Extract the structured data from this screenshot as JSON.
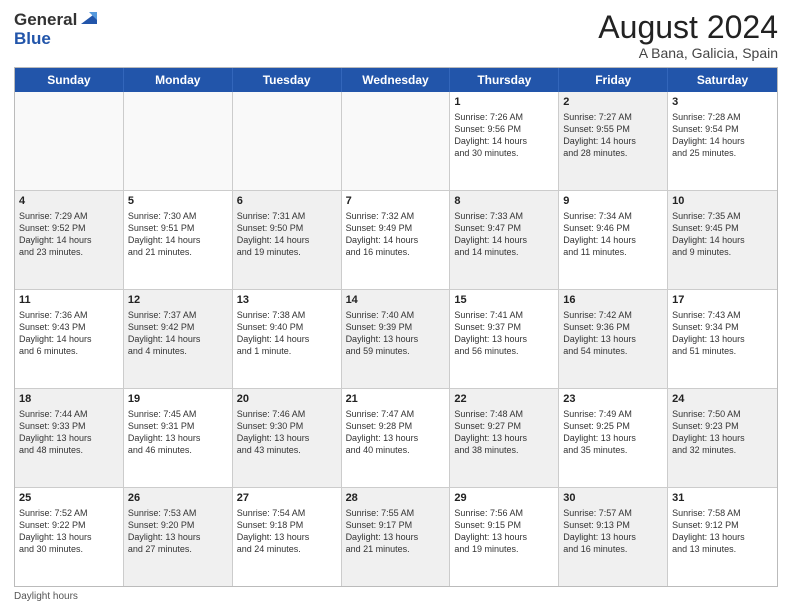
{
  "header": {
    "logo_general": "General",
    "logo_blue": "Blue",
    "month_title": "August 2024",
    "location": "A Bana, Galicia, Spain"
  },
  "weekdays": [
    "Sunday",
    "Monday",
    "Tuesday",
    "Wednesday",
    "Thursday",
    "Friday",
    "Saturday"
  ],
  "footer": "Daylight hours",
  "rows": [
    [
      {
        "day": "",
        "detail": "",
        "shaded": false,
        "empty": true
      },
      {
        "day": "",
        "detail": "",
        "shaded": false,
        "empty": true
      },
      {
        "day": "",
        "detail": "",
        "shaded": false,
        "empty": true
      },
      {
        "day": "",
        "detail": "",
        "shaded": false,
        "empty": true
      },
      {
        "day": "1",
        "detail": "Sunrise: 7:26 AM\nSunset: 9:56 PM\nDaylight: 14 hours\nand 30 minutes.",
        "shaded": false,
        "empty": false
      },
      {
        "day": "2",
        "detail": "Sunrise: 7:27 AM\nSunset: 9:55 PM\nDaylight: 14 hours\nand 28 minutes.",
        "shaded": true,
        "empty": false
      },
      {
        "day": "3",
        "detail": "Sunrise: 7:28 AM\nSunset: 9:54 PM\nDaylight: 14 hours\nand 25 minutes.",
        "shaded": false,
        "empty": false
      }
    ],
    [
      {
        "day": "4",
        "detail": "Sunrise: 7:29 AM\nSunset: 9:52 PM\nDaylight: 14 hours\nand 23 minutes.",
        "shaded": true,
        "empty": false
      },
      {
        "day": "5",
        "detail": "Sunrise: 7:30 AM\nSunset: 9:51 PM\nDaylight: 14 hours\nand 21 minutes.",
        "shaded": false,
        "empty": false
      },
      {
        "day": "6",
        "detail": "Sunrise: 7:31 AM\nSunset: 9:50 PM\nDaylight: 14 hours\nand 19 minutes.",
        "shaded": true,
        "empty": false
      },
      {
        "day": "7",
        "detail": "Sunrise: 7:32 AM\nSunset: 9:49 PM\nDaylight: 14 hours\nand 16 minutes.",
        "shaded": false,
        "empty": false
      },
      {
        "day": "8",
        "detail": "Sunrise: 7:33 AM\nSunset: 9:47 PM\nDaylight: 14 hours\nand 14 minutes.",
        "shaded": true,
        "empty": false
      },
      {
        "day": "9",
        "detail": "Sunrise: 7:34 AM\nSunset: 9:46 PM\nDaylight: 14 hours\nand 11 minutes.",
        "shaded": false,
        "empty": false
      },
      {
        "day": "10",
        "detail": "Sunrise: 7:35 AM\nSunset: 9:45 PM\nDaylight: 14 hours\nand 9 minutes.",
        "shaded": true,
        "empty": false
      }
    ],
    [
      {
        "day": "11",
        "detail": "Sunrise: 7:36 AM\nSunset: 9:43 PM\nDaylight: 14 hours\nand 6 minutes.",
        "shaded": false,
        "empty": false
      },
      {
        "day": "12",
        "detail": "Sunrise: 7:37 AM\nSunset: 9:42 PM\nDaylight: 14 hours\nand 4 minutes.",
        "shaded": true,
        "empty": false
      },
      {
        "day": "13",
        "detail": "Sunrise: 7:38 AM\nSunset: 9:40 PM\nDaylight: 14 hours\nand 1 minute.",
        "shaded": false,
        "empty": false
      },
      {
        "day": "14",
        "detail": "Sunrise: 7:40 AM\nSunset: 9:39 PM\nDaylight: 13 hours\nand 59 minutes.",
        "shaded": true,
        "empty": false
      },
      {
        "day": "15",
        "detail": "Sunrise: 7:41 AM\nSunset: 9:37 PM\nDaylight: 13 hours\nand 56 minutes.",
        "shaded": false,
        "empty": false
      },
      {
        "day": "16",
        "detail": "Sunrise: 7:42 AM\nSunset: 9:36 PM\nDaylight: 13 hours\nand 54 minutes.",
        "shaded": true,
        "empty": false
      },
      {
        "day": "17",
        "detail": "Sunrise: 7:43 AM\nSunset: 9:34 PM\nDaylight: 13 hours\nand 51 minutes.",
        "shaded": false,
        "empty": false
      }
    ],
    [
      {
        "day": "18",
        "detail": "Sunrise: 7:44 AM\nSunset: 9:33 PM\nDaylight: 13 hours\nand 48 minutes.",
        "shaded": true,
        "empty": false
      },
      {
        "day": "19",
        "detail": "Sunrise: 7:45 AM\nSunset: 9:31 PM\nDaylight: 13 hours\nand 46 minutes.",
        "shaded": false,
        "empty": false
      },
      {
        "day": "20",
        "detail": "Sunrise: 7:46 AM\nSunset: 9:30 PM\nDaylight: 13 hours\nand 43 minutes.",
        "shaded": true,
        "empty": false
      },
      {
        "day": "21",
        "detail": "Sunrise: 7:47 AM\nSunset: 9:28 PM\nDaylight: 13 hours\nand 40 minutes.",
        "shaded": false,
        "empty": false
      },
      {
        "day": "22",
        "detail": "Sunrise: 7:48 AM\nSunset: 9:27 PM\nDaylight: 13 hours\nand 38 minutes.",
        "shaded": true,
        "empty": false
      },
      {
        "day": "23",
        "detail": "Sunrise: 7:49 AM\nSunset: 9:25 PM\nDaylight: 13 hours\nand 35 minutes.",
        "shaded": false,
        "empty": false
      },
      {
        "day": "24",
        "detail": "Sunrise: 7:50 AM\nSunset: 9:23 PM\nDaylight: 13 hours\nand 32 minutes.",
        "shaded": true,
        "empty": false
      }
    ],
    [
      {
        "day": "25",
        "detail": "Sunrise: 7:52 AM\nSunset: 9:22 PM\nDaylight: 13 hours\nand 30 minutes.",
        "shaded": false,
        "empty": false
      },
      {
        "day": "26",
        "detail": "Sunrise: 7:53 AM\nSunset: 9:20 PM\nDaylight: 13 hours\nand 27 minutes.",
        "shaded": true,
        "empty": false
      },
      {
        "day": "27",
        "detail": "Sunrise: 7:54 AM\nSunset: 9:18 PM\nDaylight: 13 hours\nand 24 minutes.",
        "shaded": false,
        "empty": false
      },
      {
        "day": "28",
        "detail": "Sunrise: 7:55 AM\nSunset: 9:17 PM\nDaylight: 13 hours\nand 21 minutes.",
        "shaded": true,
        "empty": false
      },
      {
        "day": "29",
        "detail": "Sunrise: 7:56 AM\nSunset: 9:15 PM\nDaylight: 13 hours\nand 19 minutes.",
        "shaded": false,
        "empty": false
      },
      {
        "day": "30",
        "detail": "Sunrise: 7:57 AM\nSunset: 9:13 PM\nDaylight: 13 hours\nand 16 minutes.",
        "shaded": true,
        "empty": false
      },
      {
        "day": "31",
        "detail": "Sunrise: 7:58 AM\nSunset: 9:12 PM\nDaylight: 13 hours\nand 13 minutes.",
        "shaded": false,
        "empty": false
      }
    ]
  ]
}
